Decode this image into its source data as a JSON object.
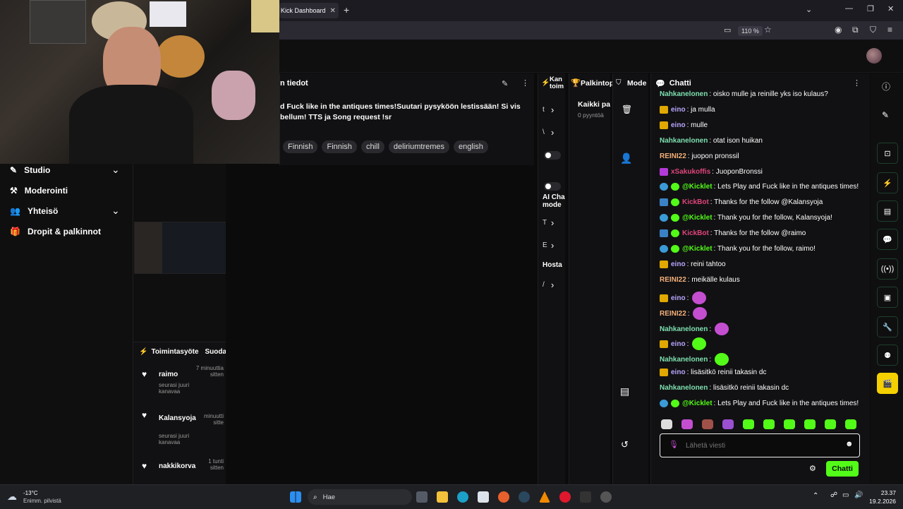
{
  "browser": {
    "tab_title": "Kick Dashboard",
    "zoom": "110 %"
  },
  "sidebar": {
    "items": [
      {
        "label": "Studio",
        "icon": "studio-icon"
      },
      {
        "label": "Moderointi",
        "icon": "hammer-icon"
      },
      {
        "label": "Yhteisö",
        "icon": "community-icon"
      },
      {
        "label": "Dropit & palkinnot",
        "icon": "gift-icon"
      }
    ]
  },
  "activity": {
    "title": "Toimintasyöte",
    "filter_label": "Suoda",
    "items": [
      {
        "user": "raimo",
        "time": "7 minuuttia sitten",
        "text": "seurasi juuri kanavaa"
      },
      {
        "user": "Kalansyoja",
        "time": "minuutti sitte",
        "text": "seurasi juuri kanavaa"
      },
      {
        "user": "nakkikorva",
        "time": "1 tunti sitten",
        "text": ""
      }
    ]
  },
  "stream_info": {
    "title": "n tiedot",
    "description_line1": "d Fuck like in the antiques times!Suutari pysyköön lestissään! Si vis",
    "description_line2": "bellum! TTS ja Song request !sr",
    "tags": [
      "Finnish",
      "Finnish",
      "chill",
      "deliriumtremes",
      "english"
    ]
  },
  "panels": {
    "kanava_title": "Kan toim",
    "palkinnot_title": "Palkintop",
    "palkinnot_sub1": "Kaikki pa",
    "palkinnot_sub2": "0 pyyntöä",
    "mod_title": "Mode",
    "ai_text1": "AI Cha",
    "ai_text2": "mode",
    "hosta": "Hosta",
    "row_letters": [
      "t",
      "\\",
      "T",
      "E",
      "/"
    ]
  },
  "chat": {
    "title": "Chatti",
    "input_placeholder": "Lähetä viesti",
    "send_label": "Chatti",
    "messages": [
      {
        "user": "Nahkanelonen",
        "color": "#7ee0b0",
        "text": ": oisko mulle ja reinille yks iso kulaus?",
        "badges": []
      },
      {
        "user": "eino",
        "color": "#b9a6ff",
        "text": ": ja mulla",
        "badges": [
          "crown"
        ]
      },
      {
        "user": "eino",
        "color": "#b9a6ff",
        "text": ": mulle",
        "badges": [
          "crown"
        ]
      },
      {
        "user": "Nahkanelonen",
        "color": "#7ee0b0",
        "text": ": otat ison huikan",
        "badges": []
      },
      {
        "user": "REINI22",
        "color": "#f4b07a",
        "text": ": juopon pronssil",
        "badges": []
      },
      {
        "user": "xSakukoffis",
        "color": "#e0457b",
        "text": ": JuoponBronssi",
        "badges": [
          "mic"
        ]
      },
      {
        "user": "@Kicklet",
        "color": "#53fc18",
        "text": ": Lets Play and Fuck like in the antiques times!",
        "badges": [
          "bot",
          "verified"
        ]
      },
      {
        "user": "KickBot",
        "color": "#e0457b",
        "text": ": Thanks for the follow @Kalansyoja",
        "badges": [
          "sword",
          "verified"
        ]
      },
      {
        "user": "@Kicklet",
        "color": "#53fc18",
        "text": ": Thank you for the follow, Kalansyoja!",
        "badges": [
          "bot",
          "verified"
        ]
      },
      {
        "user": "KickBot",
        "color": "#e0457b",
        "text": ": Thanks for the follow @raimo",
        "badges": [
          "sword",
          "verified"
        ]
      },
      {
        "user": "@Kicklet",
        "color": "#53fc18",
        "text": ": Thank you for the follow, raimo!",
        "badges": [
          "bot",
          "verified"
        ]
      },
      {
        "user": "eino",
        "color": "#b9a6ff",
        "text": ": reini tahtoo",
        "badges": [
          "crown"
        ]
      },
      {
        "user": "REINI22",
        "color": "#f4b07a",
        "text": ": meikälle kulaus",
        "badges": []
      },
      {
        "user": "eino",
        "color": "#b9a6ff",
        "text": ": ",
        "badges": [
          "crown"
        ],
        "emote": "purple"
      },
      {
        "user": "REINI22",
        "color": "#f4b07a",
        "text": ": ",
        "badges": [],
        "emote": "purple"
      },
      {
        "user": "Nahkanelonen",
        "color": "#7ee0b0",
        "text": ": ",
        "badges": [],
        "emote": "purple"
      },
      {
        "user": "eino",
        "color": "#b9a6ff",
        "text": ": ",
        "badges": [
          "crown"
        ],
        "emote": "green"
      },
      {
        "user": "Nahkanelonen",
        "color": "#7ee0b0",
        "text": ": ",
        "badges": [],
        "emote": "green"
      },
      {
        "user": "eino",
        "color": "#b9a6ff",
        "text": ": lisäsitkö reinii takasin dc",
        "badges": [
          "crown"
        ]
      },
      {
        "user": "Nahkanelonen",
        "color": "#7ee0b0",
        "text": ": lisäsitkö reinii takasin dc",
        "badges": []
      },
      {
        "user": "@Kicklet",
        "color": "#53fc18",
        "text": ": Lets Play and Fuck like in the antiques times!",
        "badges": [
          "bot",
          "verified"
        ]
      }
    ]
  },
  "taskbar": {
    "weather_temp": "-13°C",
    "weather_desc": "Enimm. pilvistä",
    "search_label": "Hae",
    "time": "23.37",
    "date": "19.2.2026"
  },
  "colors": {
    "accent": "#53fc18",
    "panel_bg": "#111113"
  }
}
